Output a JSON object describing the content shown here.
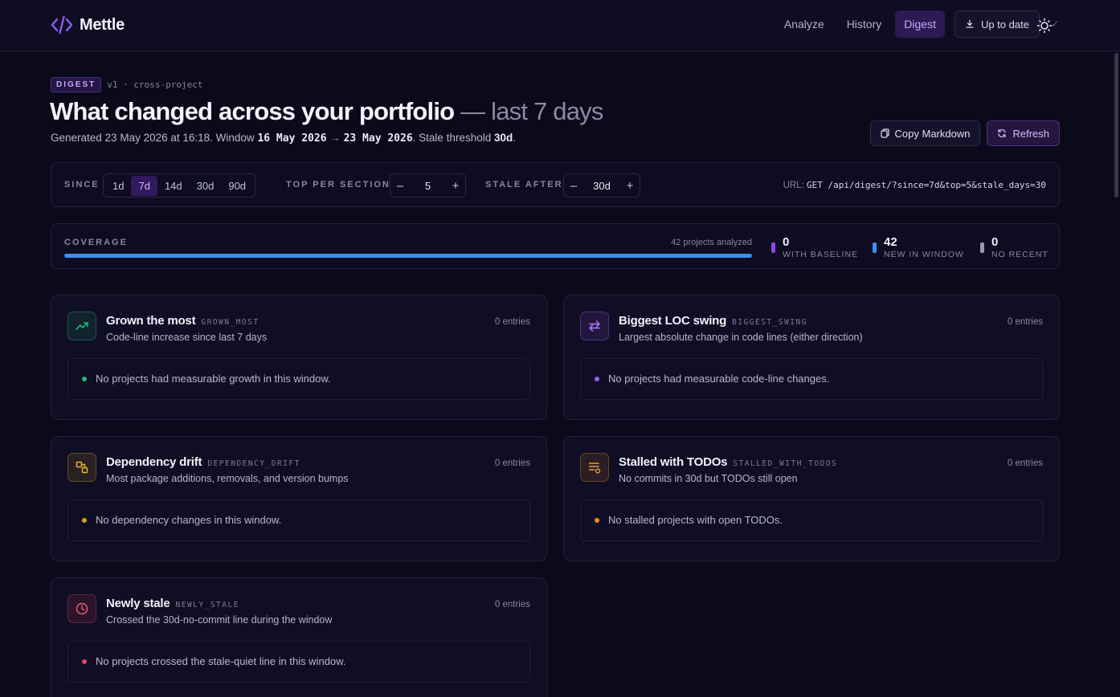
{
  "app": {
    "name": "Mettle"
  },
  "nav": {
    "items": [
      {
        "label": "Analyze",
        "active": false
      },
      {
        "label": "History",
        "active": false
      },
      {
        "label": "Digest",
        "active": true
      }
    ],
    "update_label": "Up to date",
    "update_status": "✓"
  },
  "header": {
    "tag": "DIGEST",
    "meta": "v1 · cross-project",
    "title": "What changed across your portfolio",
    "title_suffix": "— last 7 days",
    "generated_prefix": "Generated 23 May 2026 at 16:18. Window",
    "window_start": "16 May 2026",
    "window_arrow": "→",
    "window_end": "23 May 2026",
    "stale_prefix": ". Stale threshold",
    "stale_value": "30d",
    "stale_suffix": "."
  },
  "actions": {
    "copy_label": "Copy Markdown",
    "refresh_label": "Refresh"
  },
  "controls": {
    "since_label": "SINCE",
    "since_options": [
      "1d",
      "7d",
      "14d",
      "30d",
      "90d"
    ],
    "since_selected": "7d",
    "top_label": "TOP PER SECTION",
    "top_value": "5",
    "stale_label": "STALE AFTER",
    "stale_value": "30d",
    "minus": "–",
    "plus": "+",
    "url_label": "URL:",
    "url_value": "GET /api/digest/?since=7d&top=5&stale_days=30"
  },
  "coverage": {
    "label": "COVERAGE",
    "count_text": "42 projects analyzed",
    "fill_fraction": 1.0,
    "stats": [
      {
        "value": "0",
        "label": "WITH BASELINE",
        "color": "#8e46f0"
      },
      {
        "value": "42",
        "label": "NEW IN WINDOW",
        "color": "#3f8ff0"
      },
      {
        "value": "0",
        "label": "NO RECENT",
        "color": "#9c98ad"
      }
    ]
  },
  "sections": [
    {
      "title": "Grown the most",
      "code": "GROWN_MOST",
      "description": "Code-line increase since last 7 days",
      "count": "0 entries",
      "empty": "No projects had measurable growth in this window.",
      "accent": "#20b77a",
      "icon": "trend-up-icon"
    },
    {
      "title": "Biggest LOC swing",
      "code": "BIGGEST_SWING",
      "description": "Largest absolute change in code lines (either direction)",
      "count": "0 entries",
      "empty": "No projects had measurable code-line changes.",
      "accent": "#9a5cf5",
      "icon": "swap-arrows-icon"
    },
    {
      "title": "Dependency drift",
      "code": "DEPENDENCY_DRIFT",
      "description": "Most package additions, removals, and version bumps",
      "count": "0 entries",
      "empty": "No dependency changes in this window.",
      "accent": "#d7a21e",
      "icon": "packages-icon"
    },
    {
      "title": "Stalled with TODOs",
      "code": "STALLED_WITH_TODOS",
      "description": "No commits in 30d but TODOs still open",
      "count": "0 entries",
      "empty": "No stalled projects with open TODOs.",
      "accent": "#e58a2c",
      "icon": "todo-list-icon"
    },
    {
      "title": "Newly stale",
      "code": "NEWLY_STALE",
      "description": "Crossed the 30d-no-commit line during the window",
      "count": "0 entries",
      "empty": "No projects crossed the stale-quiet line in this window.",
      "accent": "#e0445e",
      "icon": "clock-icon"
    }
  ]
}
